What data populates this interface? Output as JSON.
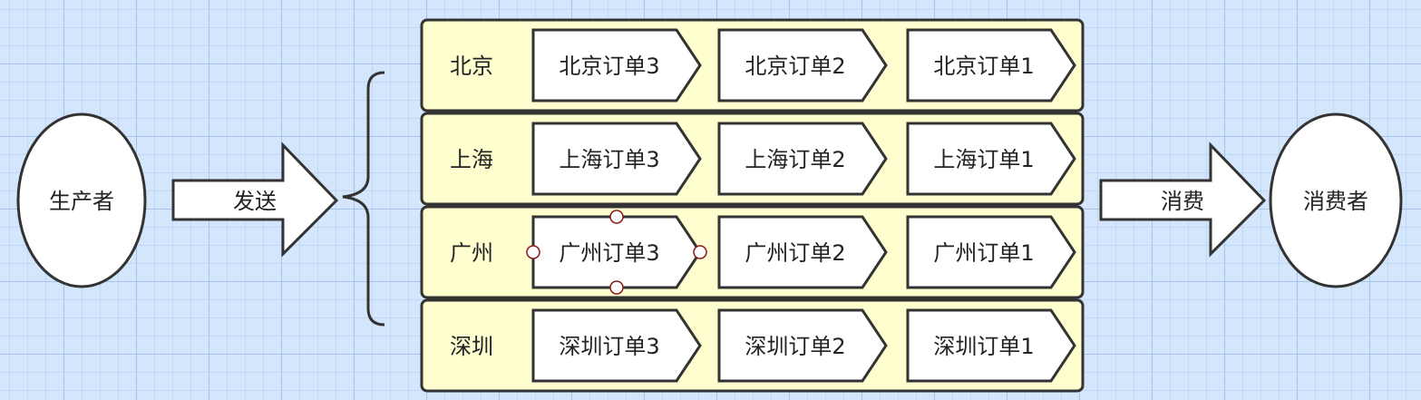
{
  "producer": {
    "label": "生产者"
  },
  "send_arrow": {
    "label": "发送"
  },
  "consume_arrow": {
    "label": "消费"
  },
  "consumer": {
    "label": "消费者"
  },
  "lanes": [
    {
      "label": "北京",
      "orders": [
        "北京订单3",
        "北京订单2",
        "北京订单1"
      ]
    },
    {
      "label": "上海",
      "orders": [
        "上海订单3",
        "上海订单2",
        "上海订单1"
      ]
    },
    {
      "label": "广州",
      "orders": [
        "广州订单3",
        "广州订单2",
        "广州订单1"
      ]
    },
    {
      "label": "深圳",
      "orders": [
        "深圳订单3",
        "深圳订单2",
        "深圳订单1"
      ]
    }
  ],
  "selected": {
    "lane": 2,
    "order": 0
  },
  "colors": {
    "background": "#d4e6fb",
    "lane_fill": "#fefecf",
    "stroke": "#333333",
    "shape_fill": "#ffffff",
    "handle_stroke": "#8a1a1a"
  }
}
